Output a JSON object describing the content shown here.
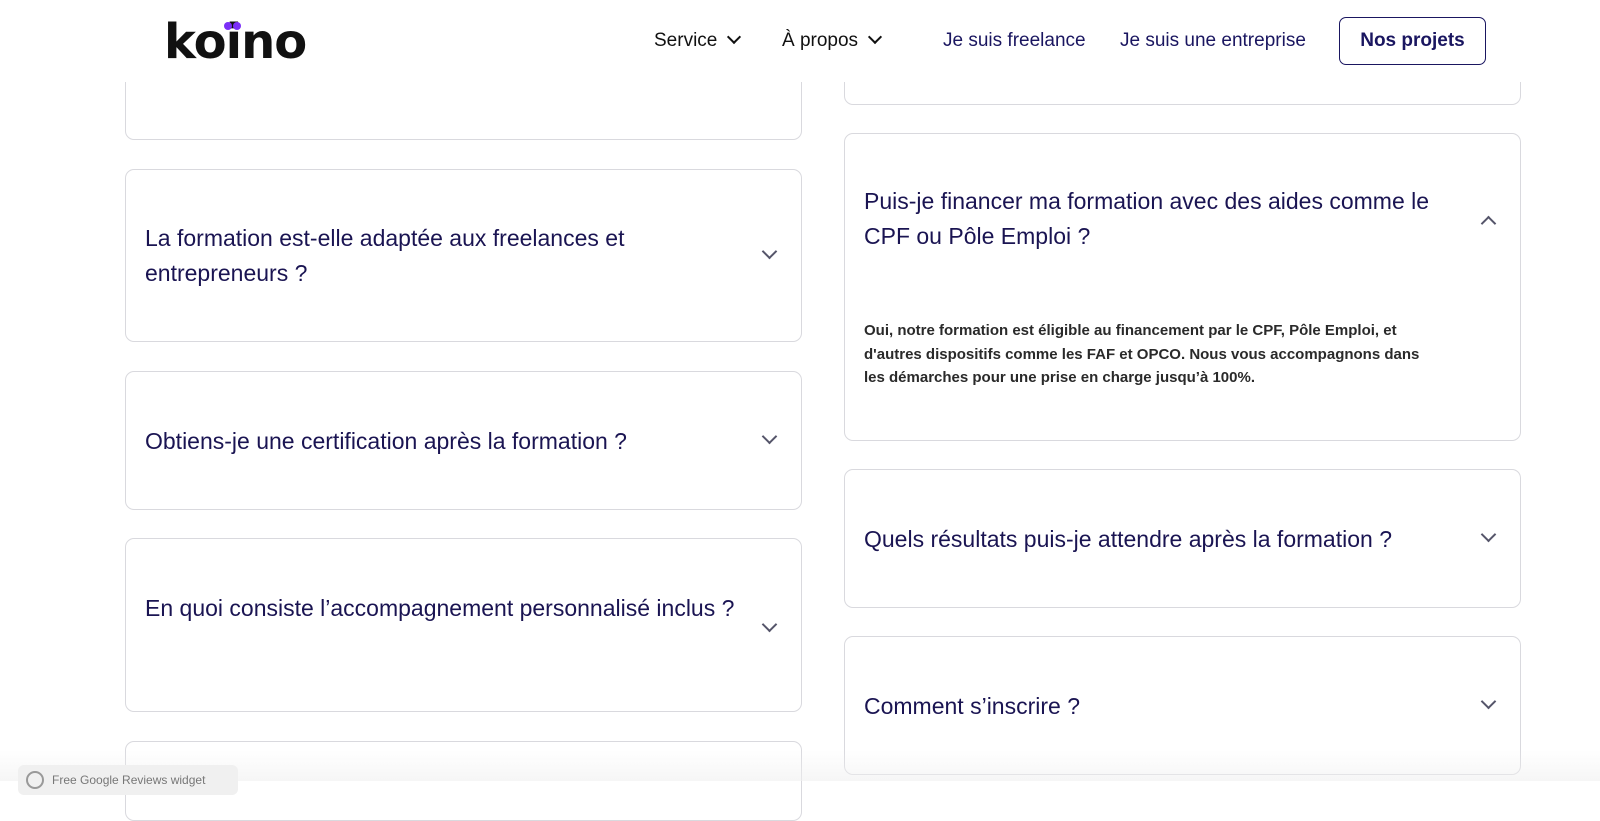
{
  "header": {
    "logo_text": "koino",
    "nav": {
      "service_label": "Service",
      "apropos_label": "À propos",
      "freelance_label": "Je suis freelance",
      "entreprise_label": "Je suis une entreprise",
      "cta_label": "Nos projets"
    }
  },
  "faq": {
    "left": [
      {
        "question": "",
        "expanded": false
      },
      {
        "question": "La formation est-elle adaptée aux freelances et entrepreneurs ?",
        "expanded": false
      },
      {
        "question": "Obtiens-je une certification après la formation ?",
        "expanded": false
      },
      {
        "question": "En quoi consiste l’accompagnement personnalisé inclus ?",
        "expanded": false
      },
      {
        "question": "",
        "expanded": false
      }
    ],
    "right": [
      {
        "question": "",
        "expanded": false
      },
      {
        "question": "Puis-je financer ma formation avec des aides comme le CPF ou Pôle Emploi ?",
        "expanded": true,
        "answer": "Oui, notre formation est éligible au financement par le CPF, Pôle Emploi, et d'autres dispositifs comme les FAF et OPCO. Nous vous accompagnons dans les démarches pour une prise en charge jusqu’à 100%."
      },
      {
        "question": "Quels résultats puis-je attendre après la formation ?",
        "expanded": false
      },
      {
        "question": "Comment s’inscrire ?",
        "expanded": false
      }
    ]
  },
  "widget": {
    "label": "Free Google Reviews widget",
    "icon": "google-reviews-icon"
  },
  "colors": {
    "brand_navy": "#1a1660",
    "logo_accent": "#7b2ff7",
    "card_border": "#d9d9de"
  }
}
